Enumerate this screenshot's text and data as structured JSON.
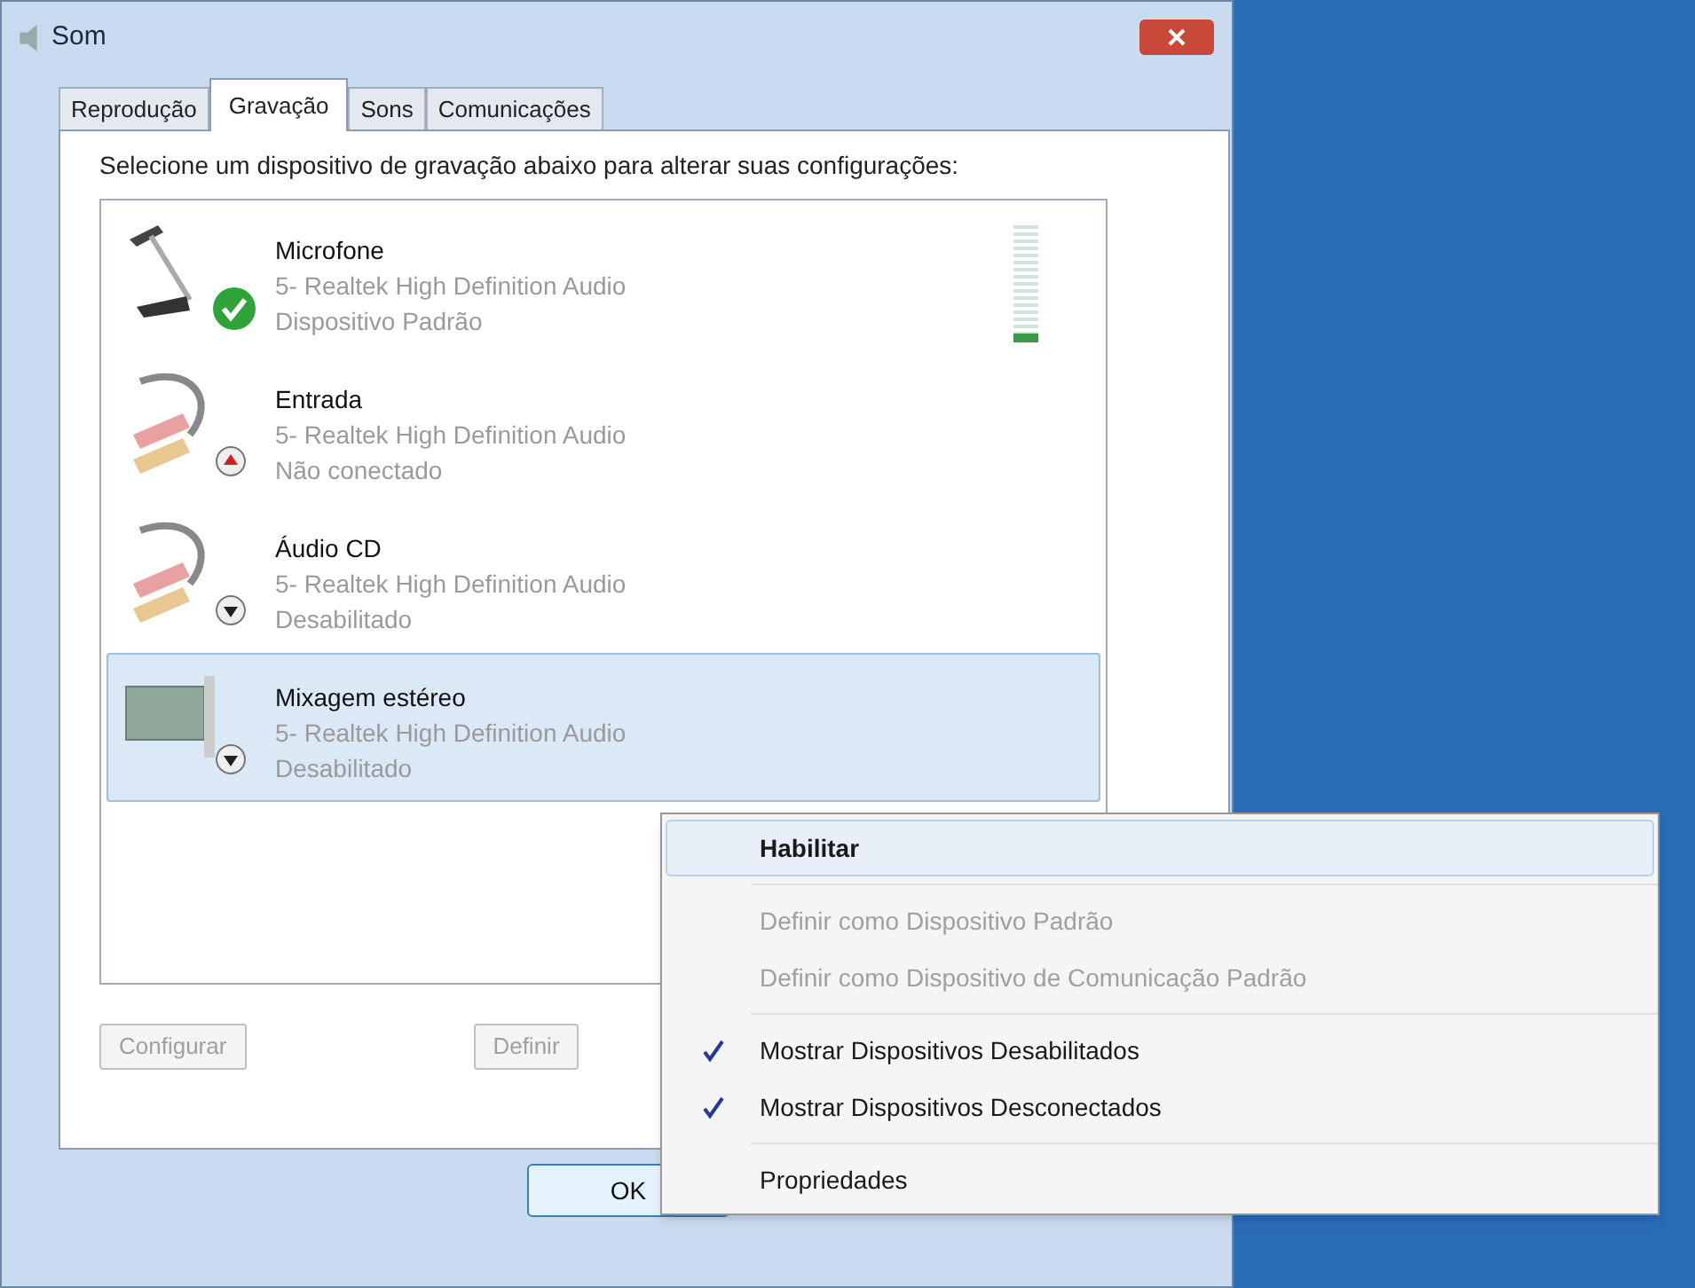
{
  "window": {
    "title": "Som"
  },
  "tabs": [
    {
      "label": "Reprodução",
      "selected": false
    },
    {
      "label": "Gravação",
      "selected": true
    },
    {
      "label": "Sons",
      "selected": false
    },
    {
      "label": "Comunicações",
      "selected": false
    }
  ],
  "instruction": "Selecione um dispositivo de gravação abaixo para alterar suas configurações:",
  "devices": [
    {
      "kind": "microphone",
      "name": "Microfone",
      "driver": "5- Realtek High Definition Audio",
      "status": "Dispositivo Padrão",
      "badge": {
        "kind": "default"
      },
      "selected": false,
      "level": 0.08
    },
    {
      "kind": "jack",
      "name": "Entrada",
      "driver": "5- Realtek High Definition Audio",
      "status": "Não conectado",
      "badge": {
        "kind": "unplugged"
      },
      "selected": false
    },
    {
      "kind": "jack",
      "name": "Áudio CD",
      "driver": "5- Realtek High Definition Audio",
      "status": "Desabilitado",
      "badge": {
        "kind": "disabled"
      },
      "selected": false
    },
    {
      "kind": "card",
      "name": "Mixagem estéreo",
      "driver": "5- Realtek High Definition Audio",
      "status": "Desabilitado",
      "badge": {
        "kind": "disabled"
      },
      "selected": true
    }
  ],
  "panel_buttons": [
    {
      "label": "Configurar",
      "disabled": true
    },
    {
      "label": "Definir",
      "disabled": true
    }
  ],
  "dialog_buttons": [
    {
      "label": "OK"
    }
  ],
  "context_menu": [
    {
      "kind": "item",
      "label": "Habilitar",
      "bold": true,
      "disabled": false,
      "checked": false,
      "selected": true
    },
    {
      "kind": "separator"
    },
    {
      "kind": "item",
      "label": "Definir como Dispositivo Padrão",
      "bold": false,
      "disabled": true,
      "checked": false,
      "selected": false
    },
    {
      "kind": "item",
      "label": "Definir como Dispositivo de Comunicação Padrão",
      "bold": false,
      "disabled": true,
      "checked": false,
      "selected": false
    },
    {
      "kind": "separator"
    },
    {
      "kind": "item",
      "label": "Mostrar Dispositivos Desabilitados",
      "bold": false,
      "disabled": false,
      "checked": true,
      "selected": false
    },
    {
      "kind": "item",
      "label": "Mostrar Dispositivos Desconectados",
      "bold": false,
      "disabled": false,
      "checked": true,
      "selected": false
    },
    {
      "kind": "separator"
    },
    {
      "kind": "item",
      "label": "Propriedades",
      "bold": false,
      "disabled": false,
      "checked": false,
      "selected": false
    }
  ]
}
